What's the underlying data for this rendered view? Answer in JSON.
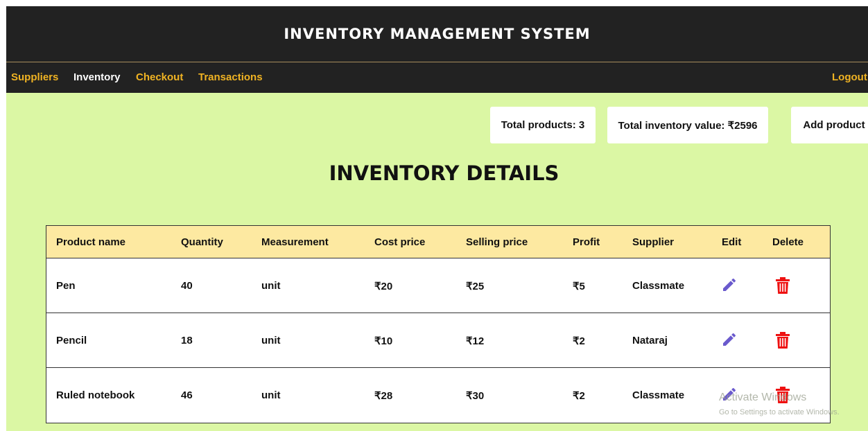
{
  "app": {
    "title": "INVENTORY MANAGEMENT SYSTEM"
  },
  "nav": {
    "items": [
      {
        "label": "Suppliers"
      },
      {
        "label": "Inventory"
      },
      {
        "label": "Checkout"
      },
      {
        "label": "Transactions"
      }
    ],
    "logout": "Logout",
    "active": "Inventory"
  },
  "stats": {
    "total_products": "Total products: 3",
    "total_value": "Total inventory value: ₹2596",
    "add_product": "Add product"
  },
  "page": {
    "heading": "INVENTORY DETAILS"
  },
  "table": {
    "headers": [
      "Product name",
      "Quantity",
      "Measurement",
      "Cost price",
      "Selling price",
      "Profit",
      "Supplier",
      "Edit",
      "Delete"
    ],
    "rows": [
      [
        "Pen",
        "40",
        "unit",
        "₹20",
        "₹25",
        "₹5",
        "Classmate"
      ],
      [
        "Pencil",
        "18",
        "unit",
        "₹10",
        "₹12",
        "₹2",
        "Nataraj"
      ],
      [
        "Ruled notebook",
        "46",
        "unit",
        "₹28",
        "₹30",
        "₹2",
        "Classmate"
      ]
    ]
  },
  "icons": {
    "edit": "pencil-icon",
    "delete": "trash-icon"
  },
  "colors": {
    "nav_bg": "#222222",
    "nav_link": "#f0b323",
    "page_bg": "#dbf7a4",
    "header_row": "#fde9a1",
    "edit_icon": "#6a5acd",
    "delete_icon": "#ee1111"
  },
  "watermark": {
    "line1": "Activate Windows",
    "line2": "Go to Settings to activate Windows."
  }
}
